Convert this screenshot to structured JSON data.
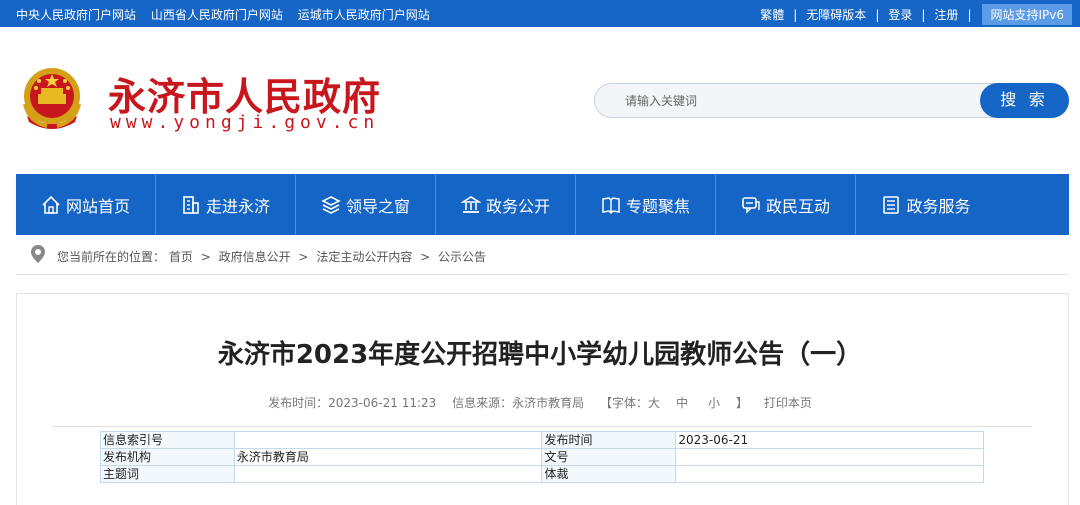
{
  "topbar": {
    "links": [
      "中央人民政府门户网站",
      "山西省人民政府门户网站",
      "运城市人民政府门户网站"
    ],
    "traditional": "繁體",
    "accessible": "无障碍版本",
    "login": "登录",
    "register": "注册",
    "ipv6": "网站支持IPv6"
  },
  "header": {
    "title": "永济市人民政府",
    "url": "www.yongji.gov.cn"
  },
  "search": {
    "placeholder": "请输入关键词",
    "button": "搜 索"
  },
  "nav": {
    "items": [
      {
        "label": "网站首页",
        "icon": "home-icon"
      },
      {
        "label": "走进永济",
        "icon": "building-icon"
      },
      {
        "label": "领导之窗",
        "icon": "layers-icon"
      },
      {
        "label": "政务公开",
        "icon": "bank-icon"
      },
      {
        "label": "专题聚焦",
        "icon": "book-icon"
      },
      {
        "label": "政民互动",
        "icon": "chat-icon"
      },
      {
        "label": "政务服务",
        "icon": "document-icon"
      }
    ]
  },
  "breadcrumb": {
    "prefix": "您当前所在的位置：",
    "items": [
      "首页",
      "政府信息公开",
      "法定主动公开内容",
      "公示公告"
    ],
    "separator": ">"
  },
  "article": {
    "title": "永济市2023年度公开招聘中小学幼儿园教师公告（一）",
    "publish_time": "发布时间：2023-06-21 11:23",
    "source": "信息来源：永济市教育局",
    "font_label": "【字体：大",
    "font_medium": "中",
    "font_small": "小",
    "font_close": "】",
    "print": "打印本页"
  },
  "info_table": {
    "rows": [
      {
        "l1": "信息索引号",
        "v1": "",
        "l2": "发布时间",
        "v2": "2023-06-21"
      },
      {
        "l1": "发布机构",
        "v1": "永济市教育局",
        "l2": "文号",
        "v2": ""
      },
      {
        "l1": "主题词",
        "v1": "",
        "l2": "体裁",
        "v2": ""
      }
    ]
  },
  "colors": {
    "primary_blue": "#1565c6",
    "brand_red": "#c8161d"
  }
}
